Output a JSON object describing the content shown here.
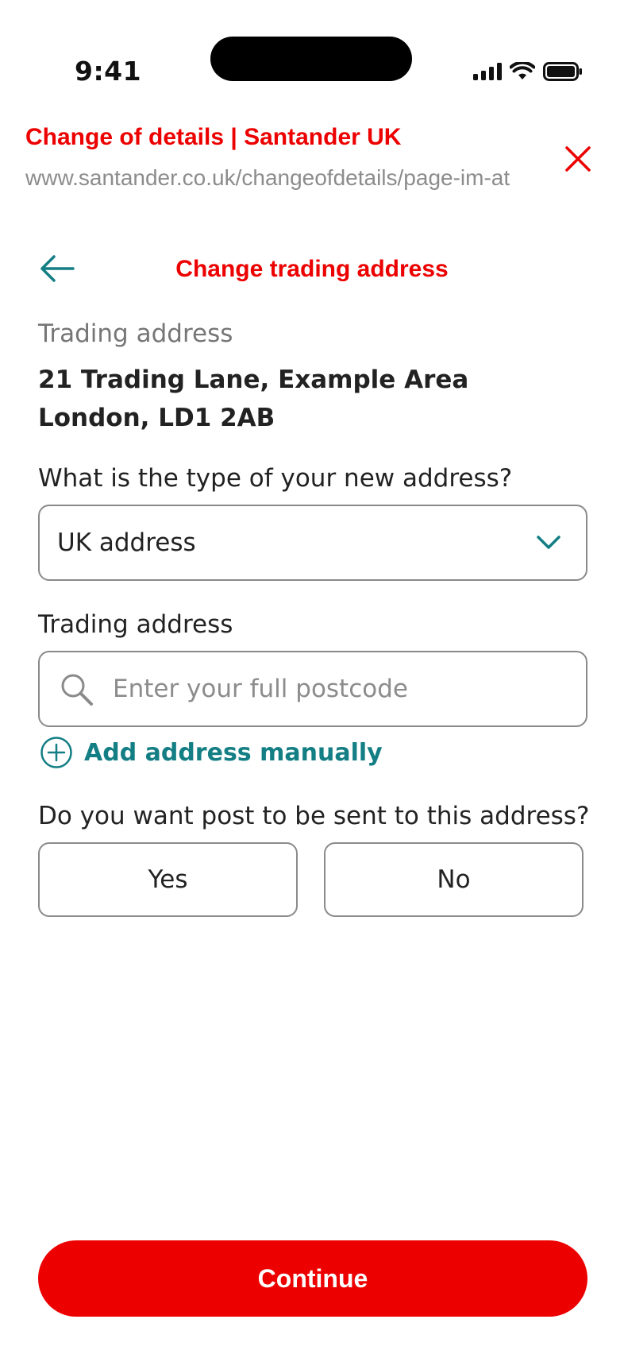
{
  "status_bar": {
    "time": "9:41",
    "icons": [
      "cellular-signal-icon",
      "wifi-icon",
      "battery-icon"
    ]
  },
  "browser": {
    "page_title": "Change of details | Santander UK",
    "url": "www.santander.co.uk/changeofdetails/page-im-at",
    "close_icon": "close-icon"
  },
  "nav": {
    "back_icon": "arrow-left-icon",
    "title": "Change trading address"
  },
  "current": {
    "label": "Trading address",
    "line1": "21 Trading Lane, Example Area",
    "line2": "London, LD1 2AB"
  },
  "address_type": {
    "question": "What is the type of your new address?",
    "selected": "UK address",
    "chevron_icon": "chevron-down-icon"
  },
  "postcode_search": {
    "label": "Trading address",
    "placeholder": "Enter your full postcode",
    "value": "",
    "icon": "search-icon"
  },
  "add_manual": {
    "icon": "plus-circle-icon",
    "label": "Add address manually"
  },
  "post_question": {
    "question": "Do you want post to be sent to this address?",
    "yes_label": "Yes",
    "no_label": "No"
  },
  "footer": {
    "continue_label": "Continue"
  },
  "colors": {
    "brand_red": "#ec0000",
    "accent_teal": "#137e84",
    "muted_text": "#767676",
    "border": "#8a8a8a"
  }
}
